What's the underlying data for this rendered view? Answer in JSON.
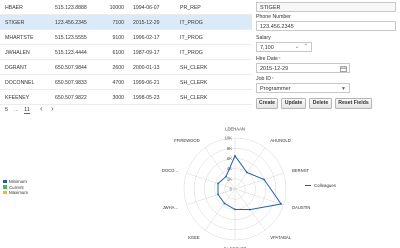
{
  "table": {
    "rows": [
      {
        "id": "HBAER",
        "phone": "515.123.8888",
        "salary": "10000",
        "hire": "1994-06-07",
        "job": "PR_REP",
        "selected": false
      },
      {
        "id": "STIGER",
        "phone": "123.456.2345",
        "salary": "7100",
        "hire": "2015-12-29",
        "job": "IT_PROG",
        "selected": true
      },
      {
        "id": "MHARTSTE",
        "phone": "515.123.5555",
        "salary": "9100",
        "hire": "1996-02-17",
        "job": "IT_PROG",
        "selected": false
      },
      {
        "id": "JWHALEN",
        "phone": "515.123.4444",
        "salary": "6100",
        "hire": "1987-09-17",
        "job": "IT_PROG",
        "selected": false
      },
      {
        "id": "DGRANT",
        "phone": "650.507.9844",
        "salary": "2600",
        "hire": "2000-01-13",
        "job": "SH_CLERK",
        "selected": false
      },
      {
        "id": "DOCONNEL",
        "phone": "650.507.9833",
        "salary": "4700",
        "hire": "1999-06-21",
        "job": "SH_CLERK",
        "selected": false
      },
      {
        "id": "KFEENEY",
        "phone": "650.507.9822",
        "salary": "3000",
        "hire": "1998-05-23",
        "job": "SH_CLERK",
        "selected": false
      }
    ]
  },
  "pager": {
    "first": "5",
    "ellipsis": "...",
    "current": "11",
    "prev": "‹",
    "next": "›"
  },
  "form": {
    "name_value": "STIGER",
    "phone_label": "Phone Number",
    "phone_value": "123.456.2345",
    "salary_label": "Salary",
    "salary_value": "7,100",
    "spin_down": "⌄",
    "spin_up": "⌃",
    "hire_label": "Hire Date",
    "hire_value": "2015-12-29",
    "job_label": "Job ID",
    "job_value": "Programmer",
    "required_mark": "*"
  },
  "buttons": {
    "create": "Create",
    "update": "Update",
    "delete": "Delete",
    "reset": "Reset Fields"
  },
  "icons": {
    "calendar": "calendar-icon",
    "dropdown": "chevron-down-icon"
  },
  "chart_data": {
    "type": "radar",
    "categories": [
      "LDEHAAN",
      "AHUNOLD",
      "BERNST",
      "DAUSTIN",
      "VPATABAL",
      "DLORENTZ",
      "KGEE",
      "JWHA...",
      "DOCO...",
      "FFIREWOOD"
    ],
    "ticks": [
      "10K",
      "8K",
      "6K",
      "4K",
      "2K",
      "0"
    ],
    "ylim": [
      0,
      10000
    ],
    "series": [
      {
        "name": "Minimum",
        "color": "#1f5fa6",
        "values": [
          null,
          null,
          null,
          null,
          null,
          null,
          null,
          null,
          null,
          null
        ]
      },
      {
        "name": "Current",
        "color": "#52b74a",
        "values": [
          null,
          null,
          null,
          null,
          null,
          null,
          null,
          null,
          null,
          null
        ]
      },
      {
        "name": "Maximum",
        "color": "#f2b637",
        "values": [
          null,
          null,
          null,
          null,
          null,
          null,
          null,
          null,
          null,
          null
        ]
      },
      {
        "name": "Colleagues",
        "color": "#1f5fa6",
        "values": [
          6500,
          4000,
          6000,
          9500,
          5000,
          4000,
          3500,
          3500,
          3500,
          3000
        ]
      }
    ]
  }
}
